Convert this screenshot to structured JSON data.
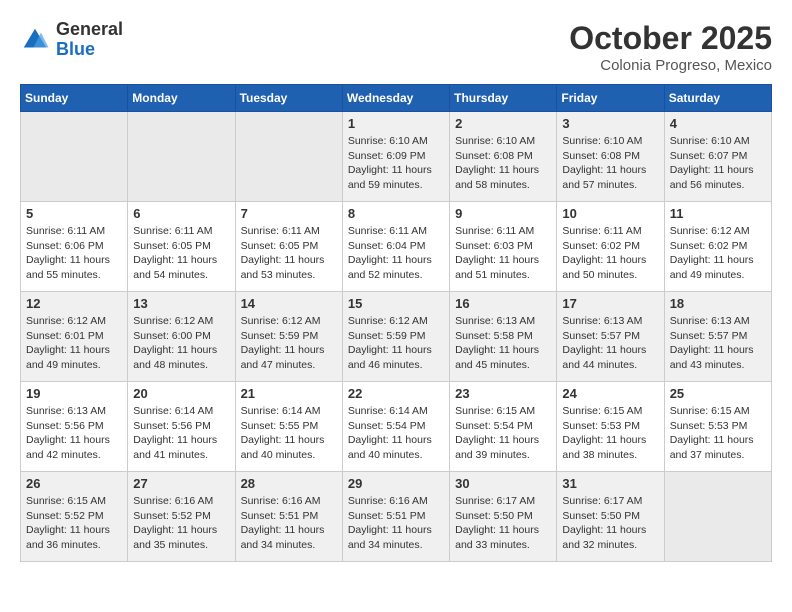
{
  "logo": {
    "general": "General",
    "blue": "Blue"
  },
  "title": "October 2025",
  "subtitle": "Colonia Progreso, Mexico",
  "days_of_week": [
    "Sunday",
    "Monday",
    "Tuesday",
    "Wednesday",
    "Thursday",
    "Friday",
    "Saturday"
  ],
  "weeks": [
    [
      {
        "day": "",
        "info": ""
      },
      {
        "day": "",
        "info": ""
      },
      {
        "day": "",
        "info": ""
      },
      {
        "day": "1",
        "info": "Sunrise: 6:10 AM\nSunset: 6:09 PM\nDaylight: 11 hours and 59 minutes."
      },
      {
        "day": "2",
        "info": "Sunrise: 6:10 AM\nSunset: 6:08 PM\nDaylight: 11 hours and 58 minutes."
      },
      {
        "day": "3",
        "info": "Sunrise: 6:10 AM\nSunset: 6:08 PM\nDaylight: 11 hours and 57 minutes."
      },
      {
        "day": "4",
        "info": "Sunrise: 6:10 AM\nSunset: 6:07 PM\nDaylight: 11 hours and 56 minutes."
      }
    ],
    [
      {
        "day": "5",
        "info": "Sunrise: 6:11 AM\nSunset: 6:06 PM\nDaylight: 11 hours and 55 minutes."
      },
      {
        "day": "6",
        "info": "Sunrise: 6:11 AM\nSunset: 6:05 PM\nDaylight: 11 hours and 54 minutes."
      },
      {
        "day": "7",
        "info": "Sunrise: 6:11 AM\nSunset: 6:05 PM\nDaylight: 11 hours and 53 minutes."
      },
      {
        "day": "8",
        "info": "Sunrise: 6:11 AM\nSunset: 6:04 PM\nDaylight: 11 hours and 52 minutes."
      },
      {
        "day": "9",
        "info": "Sunrise: 6:11 AM\nSunset: 6:03 PM\nDaylight: 11 hours and 51 minutes."
      },
      {
        "day": "10",
        "info": "Sunrise: 6:11 AM\nSunset: 6:02 PM\nDaylight: 11 hours and 50 minutes."
      },
      {
        "day": "11",
        "info": "Sunrise: 6:12 AM\nSunset: 6:02 PM\nDaylight: 11 hours and 49 minutes."
      }
    ],
    [
      {
        "day": "12",
        "info": "Sunrise: 6:12 AM\nSunset: 6:01 PM\nDaylight: 11 hours and 49 minutes."
      },
      {
        "day": "13",
        "info": "Sunrise: 6:12 AM\nSunset: 6:00 PM\nDaylight: 11 hours and 48 minutes."
      },
      {
        "day": "14",
        "info": "Sunrise: 6:12 AM\nSunset: 5:59 PM\nDaylight: 11 hours and 47 minutes."
      },
      {
        "day": "15",
        "info": "Sunrise: 6:12 AM\nSunset: 5:59 PM\nDaylight: 11 hours and 46 minutes."
      },
      {
        "day": "16",
        "info": "Sunrise: 6:13 AM\nSunset: 5:58 PM\nDaylight: 11 hours and 45 minutes."
      },
      {
        "day": "17",
        "info": "Sunrise: 6:13 AM\nSunset: 5:57 PM\nDaylight: 11 hours and 44 minutes."
      },
      {
        "day": "18",
        "info": "Sunrise: 6:13 AM\nSunset: 5:57 PM\nDaylight: 11 hours and 43 minutes."
      }
    ],
    [
      {
        "day": "19",
        "info": "Sunrise: 6:13 AM\nSunset: 5:56 PM\nDaylight: 11 hours and 42 minutes."
      },
      {
        "day": "20",
        "info": "Sunrise: 6:14 AM\nSunset: 5:56 PM\nDaylight: 11 hours and 41 minutes."
      },
      {
        "day": "21",
        "info": "Sunrise: 6:14 AM\nSunset: 5:55 PM\nDaylight: 11 hours and 40 minutes."
      },
      {
        "day": "22",
        "info": "Sunrise: 6:14 AM\nSunset: 5:54 PM\nDaylight: 11 hours and 40 minutes."
      },
      {
        "day": "23",
        "info": "Sunrise: 6:15 AM\nSunset: 5:54 PM\nDaylight: 11 hours and 39 minutes."
      },
      {
        "day": "24",
        "info": "Sunrise: 6:15 AM\nSunset: 5:53 PM\nDaylight: 11 hours and 38 minutes."
      },
      {
        "day": "25",
        "info": "Sunrise: 6:15 AM\nSunset: 5:53 PM\nDaylight: 11 hours and 37 minutes."
      }
    ],
    [
      {
        "day": "26",
        "info": "Sunrise: 6:15 AM\nSunset: 5:52 PM\nDaylight: 11 hours and 36 minutes."
      },
      {
        "day": "27",
        "info": "Sunrise: 6:16 AM\nSunset: 5:52 PM\nDaylight: 11 hours and 35 minutes."
      },
      {
        "day": "28",
        "info": "Sunrise: 6:16 AM\nSunset: 5:51 PM\nDaylight: 11 hours and 34 minutes."
      },
      {
        "day": "29",
        "info": "Sunrise: 6:16 AM\nSunset: 5:51 PM\nDaylight: 11 hours and 34 minutes."
      },
      {
        "day": "30",
        "info": "Sunrise: 6:17 AM\nSunset: 5:50 PM\nDaylight: 11 hours and 33 minutes."
      },
      {
        "day": "31",
        "info": "Sunrise: 6:17 AM\nSunset: 5:50 PM\nDaylight: 11 hours and 32 minutes."
      },
      {
        "day": "",
        "info": ""
      }
    ]
  ]
}
